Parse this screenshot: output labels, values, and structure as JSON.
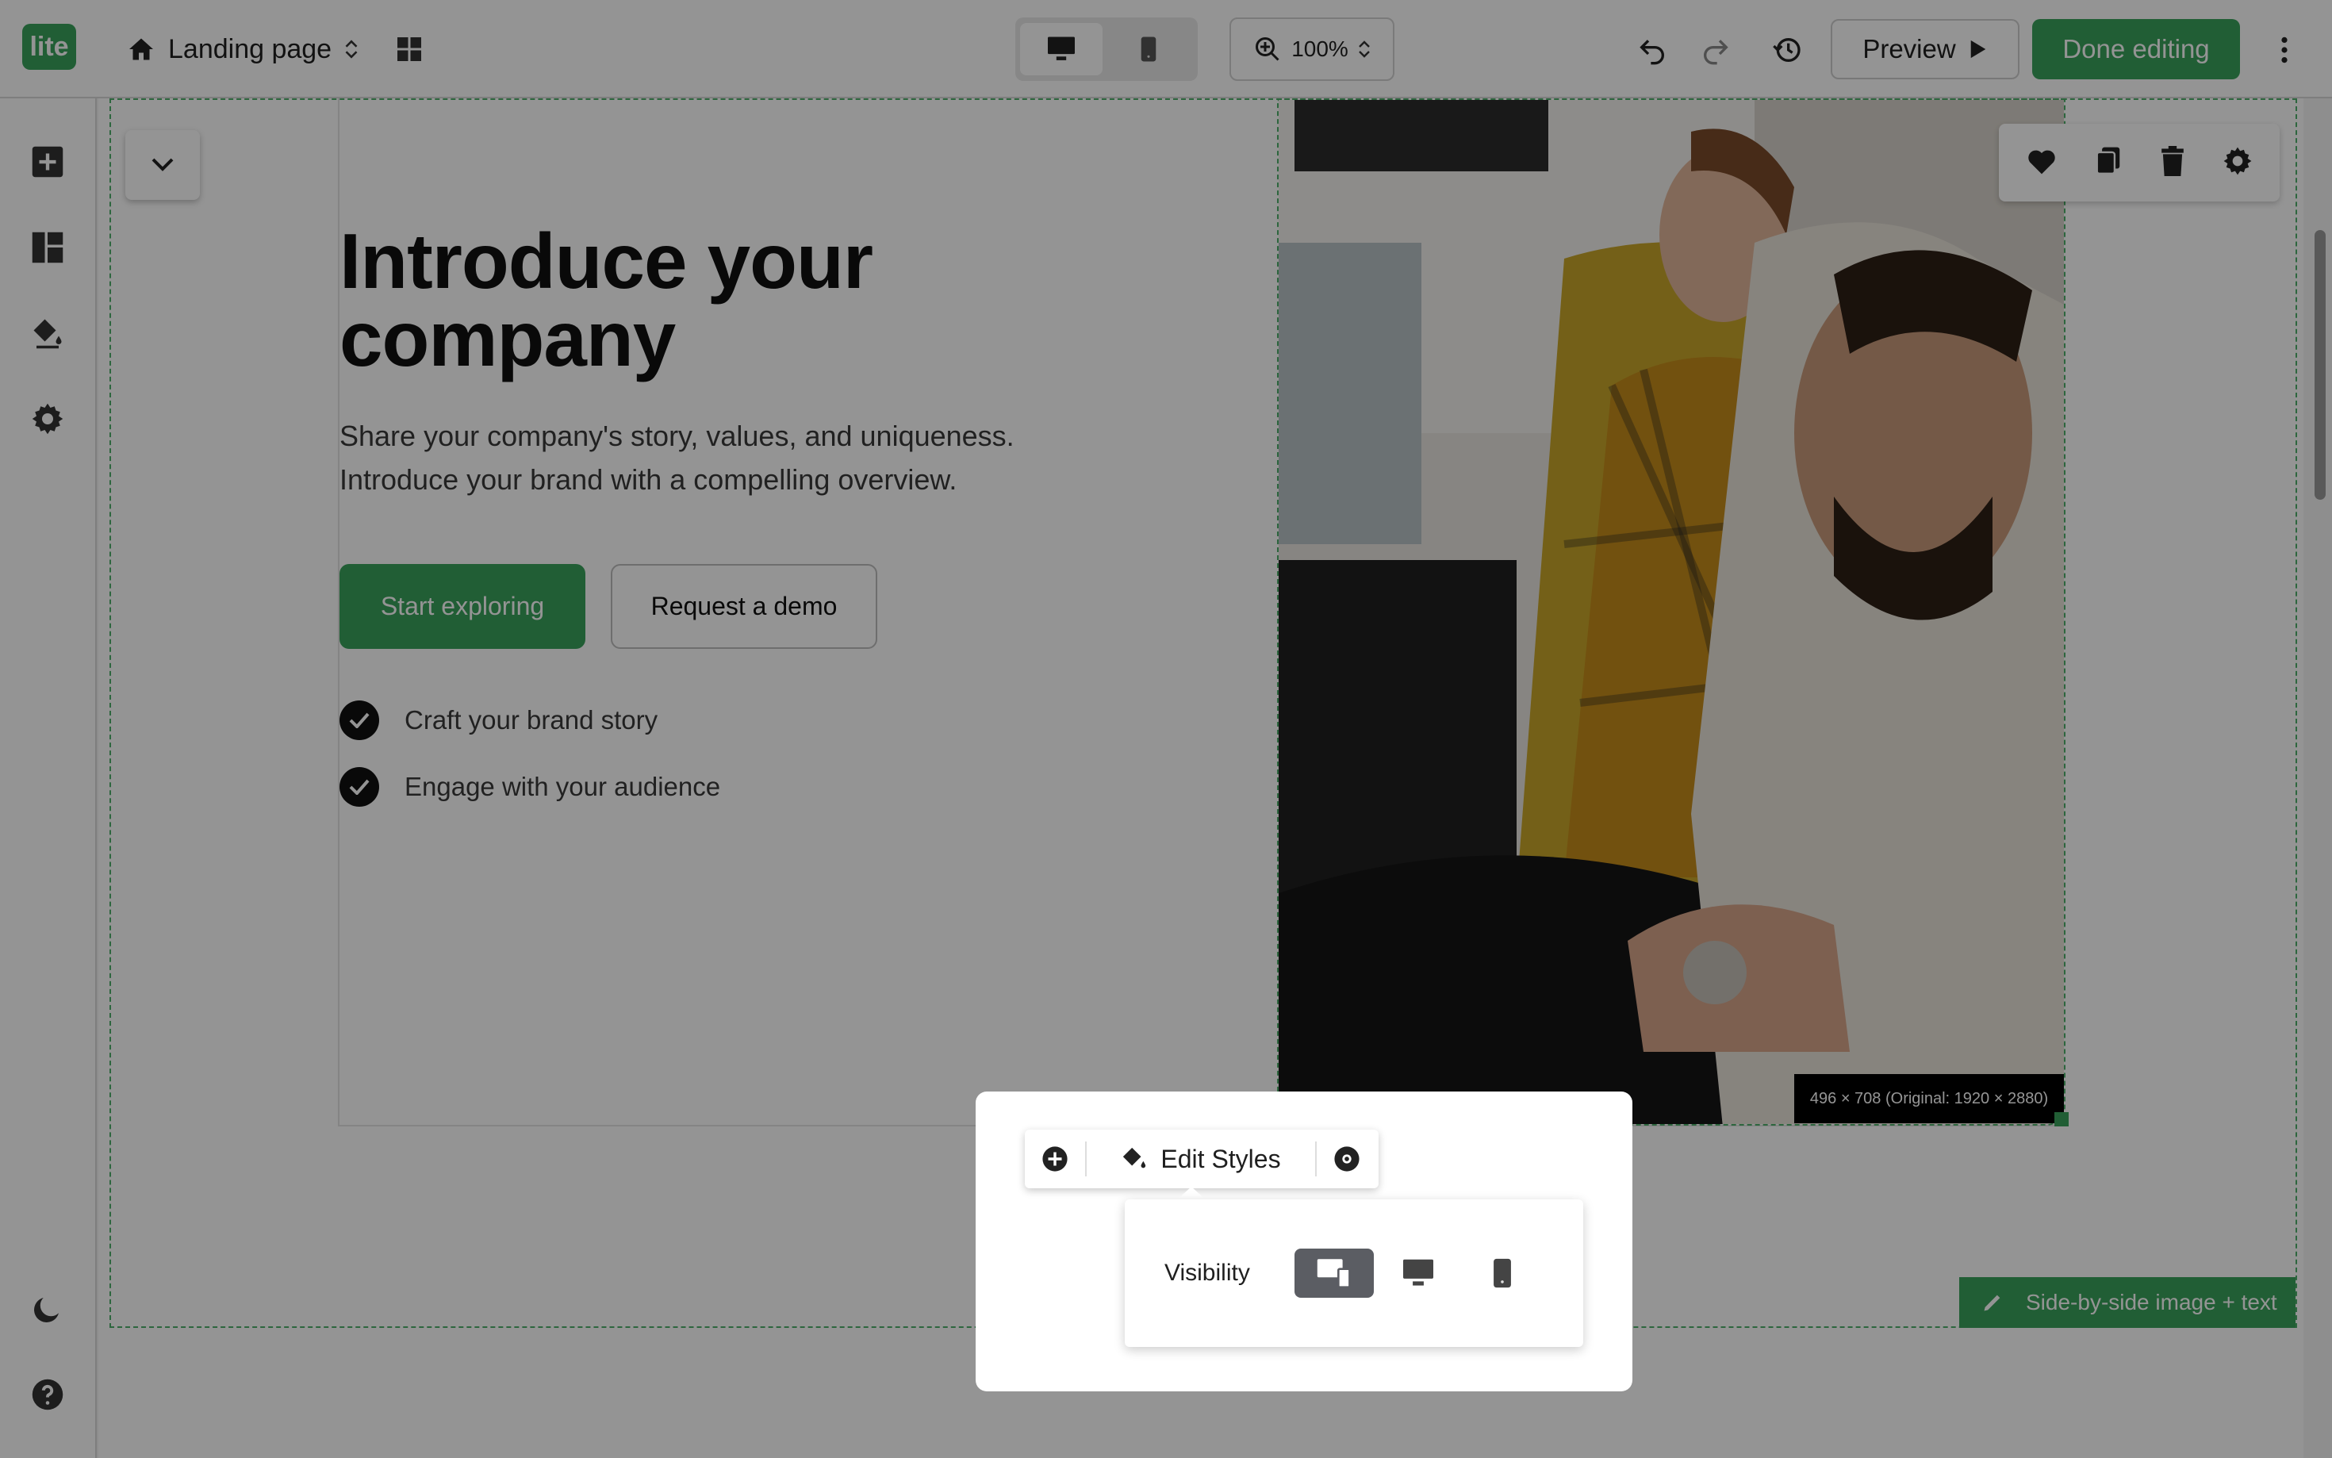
{
  "topbar": {
    "logo_text": "lite",
    "page_name": "Landing page",
    "zoom": "100%",
    "preview_label": "Preview",
    "done_label": "Done editing"
  },
  "hero": {
    "title_line1": "Introduce your",
    "title_line2": "company",
    "subtitle_line1": "Share your company's story, values, and uniqueness.",
    "subtitle_line2": "Introduce your brand with a compelling overview.",
    "primary_cta": "Start exploring",
    "secondary_cta": "Request a demo",
    "features": [
      "Craft your brand story",
      "Engage with your audience"
    ]
  },
  "image": {
    "dimensions_label": "496 × 708 (Original: 1920 × 2880)"
  },
  "popup": {
    "edit_styles_label": "Edit Styles",
    "visibility_label": "Visibility"
  },
  "section": {
    "tag_label": "Side-by-side image + text"
  },
  "colors": {
    "accent": "#3aa35c",
    "overlay": "rgba(0,0,0,0.42)"
  }
}
